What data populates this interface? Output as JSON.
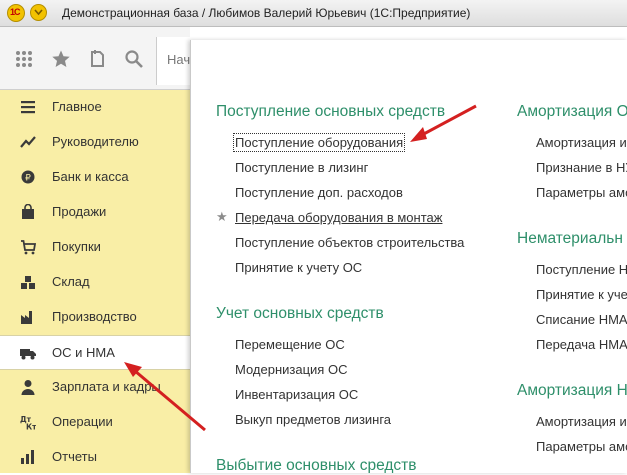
{
  "window": {
    "title": "Демонстрационная база / Любимов Валерий Юрьевич  (1С:Предприятие)",
    "logo_text": "1С"
  },
  "toolbar": {
    "icons": [
      "apps-grid-icon",
      "star-icon",
      "history-icon",
      "search-icon"
    ],
    "search_partial": "Нач"
  },
  "sidebar": {
    "items": [
      {
        "label": "Главное",
        "icon": "menu-lines-icon"
      },
      {
        "label": "Руководителю",
        "icon": "trend-icon"
      },
      {
        "label": "Банк и касса",
        "icon": "bank-icon"
      },
      {
        "label": "Продажи",
        "icon": "bag-icon"
      },
      {
        "label": "Покупки",
        "icon": "cart-icon"
      },
      {
        "label": "Склад",
        "icon": "warehouse-icon"
      },
      {
        "label": "Производство",
        "icon": "factory-icon"
      },
      {
        "label": "ОС и НМА",
        "icon": "truck-icon"
      },
      {
        "label": "Зарплата и кадры",
        "icon": "person-icon"
      },
      {
        "label": "Операции",
        "icon": "operations-icon"
      },
      {
        "label": "Отчеты",
        "icon": "report-icon"
      }
    ],
    "active_index": 7
  },
  "panel": {
    "col1": {
      "sections": [
        {
          "title": "Поступление основных средств",
          "links": [
            "Поступление оборудования",
            "Поступление в лизинг",
            "Поступление доп. расходов",
            "Передача оборудования в монтаж",
            "Поступление объектов строительства",
            "Принятие к учету ОС"
          ]
        },
        {
          "title": "Учет основных средств",
          "links": [
            "Перемещение ОС",
            "Модернизация ОС",
            "Инвентаризация ОС",
            "Выкуп предметов лизинга"
          ]
        },
        {
          "title": "Выбытие основных средств",
          "links": []
        }
      ]
    },
    "col2": {
      "sections": [
        {
          "title": "Амортизация О",
          "links": [
            "Амортизация и",
            "Признание в НУ",
            "Параметры амо"
          ]
        },
        {
          "title": "Нематериальн",
          "links": [
            "Поступление Н",
            "Принятие к уче",
            "Списание НМА",
            "Передача НМА"
          ]
        },
        {
          "title": "Амортизация Н",
          "links": [
            "Амортизация и",
            "Параметры амо"
          ]
        }
      ]
    },
    "selected_link": "Поступление оборудования",
    "favorite_link": "Передача оборудования в монтаж"
  },
  "annotations": {
    "arrow_color": "#d42020"
  }
}
